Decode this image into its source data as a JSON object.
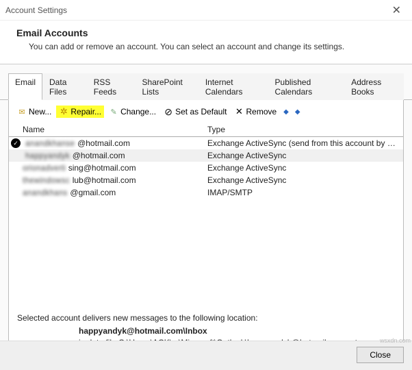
{
  "window": {
    "title": "Account Settings",
    "close_glyph": "✕"
  },
  "header": {
    "title": "Email Accounts",
    "subtitle": "You can add or remove an account. You can select an account and change its settings."
  },
  "tabs": [
    {
      "label": "Email",
      "active": true
    },
    {
      "label": "Data Files",
      "active": false
    },
    {
      "label": "RSS Feeds",
      "active": false
    },
    {
      "label": "SharePoint Lists",
      "active": false
    },
    {
      "label": "Internet Calendars",
      "active": false
    },
    {
      "label": "Published Calendars",
      "active": false
    },
    {
      "label": "Address Books",
      "active": false
    }
  ],
  "toolbar": {
    "new_label": "New...",
    "repair_label": "Repair...",
    "change_label": "Change...",
    "default_label": "Set as Default",
    "remove_label": "Remove"
  },
  "table": {
    "columns": {
      "name": "Name",
      "type": "Type"
    },
    "rows": [
      {
        "prefix": "anandkhanse",
        "email": "@hotmail.com",
        "type": "Exchange ActiveSync (send from this account by def...",
        "default": true,
        "selected": false
      },
      {
        "prefix": "happyandyk",
        "email": "@hotmail.com",
        "type": "Exchange ActiveSync",
        "default": false,
        "selected": true
      },
      {
        "prefix": "orionadverti",
        "email": "sing@hotmail.com",
        "type": "Exchange ActiveSync",
        "default": false,
        "selected": false
      },
      {
        "prefix": "thewindowsc",
        "email": "lub@hotmail.com",
        "type": "Exchange ActiveSync",
        "default": false,
        "selected": false
      },
      {
        "prefix": "anandkhans",
        "email": "@gmail.com",
        "type": "IMAP/SMTP",
        "default": false,
        "selected": false
      }
    ]
  },
  "location": {
    "intro": "Selected account delivers new messages to the following location:",
    "folder": "happyandyk@hotmail.com\\Inbox",
    "path": "in data file C:\\Users\\ACK\\...\\Microsoft\\Outlook\\happyandyk@hotmail.com.ost"
  },
  "footer": {
    "close_label": "Close"
  },
  "watermark": "wsxdn.com"
}
